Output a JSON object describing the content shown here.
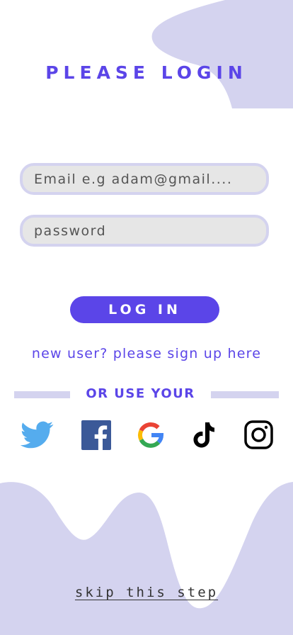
{
  "title": "PLEASE LOGIN",
  "email": {
    "placeholder": "Email e.g adam@gmail...."
  },
  "password": {
    "placeholder": "password"
  },
  "login_button": "LOG IN",
  "signup_link": "new user? please sign up here",
  "divider_text": "OR USE YOUR",
  "social": [
    "twitter-icon",
    "facebook-icon",
    "google-icon",
    "tiktok-icon",
    "instagram-icon"
  ],
  "skip_link": "skip this step",
  "colors": {
    "accent": "#5b45e8",
    "blob": "#d4d3ef",
    "field_bg": "#e6e6e6",
    "twitter": "#55acee",
    "facebook": "#3b5998"
  }
}
